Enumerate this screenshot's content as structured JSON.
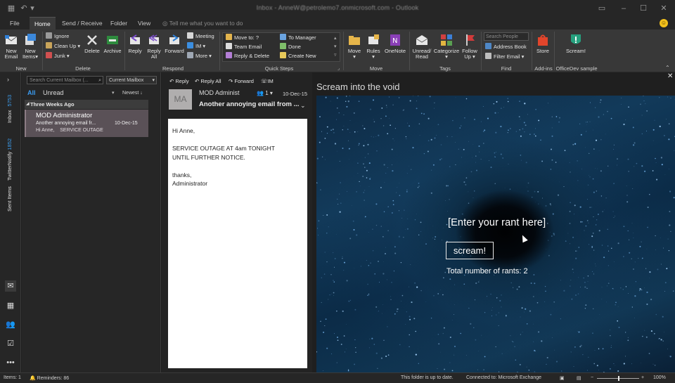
{
  "window": {
    "title": "Inbox - AnneW@petrolemo7.onmicrosoft.com - Outlook",
    "controls": [
      "ribbon-display-icon",
      "minimize-icon",
      "maximize-icon",
      "close-icon"
    ]
  },
  "menu": {
    "tabs": [
      "File",
      "Home",
      "Send / Receive",
      "Folder",
      "View"
    ],
    "active_tab": "Home",
    "tell_me": "Tell me what you want to do"
  },
  "ribbon": {
    "new": {
      "new_email": [
        "New",
        "Email"
      ],
      "new_items": [
        "New",
        "Items"
      ],
      "group": "New"
    },
    "delete": {
      "ignore": "Ignore",
      "cleanup": "Clean Up",
      "junk": "Junk",
      "delete": "Delete",
      "archive": "Archive",
      "group": "Delete"
    },
    "respond": {
      "reply": "Reply",
      "reply_all": [
        "Reply",
        "All"
      ],
      "forward": "Forward",
      "meeting": "Meeting",
      "im": "IM",
      "more": "More",
      "group": "Respond"
    },
    "quick_steps": {
      "items": [
        "Move to: ?",
        "Team Email",
        "Reply & Delete",
        "To Manager",
        "Done",
        "Create New"
      ],
      "group": "Quick Steps"
    },
    "move": {
      "move": "Move",
      "rules": "Rules",
      "onenote": "OneNote",
      "group": "Move"
    },
    "tags": {
      "unread_read": [
        "Unread/",
        "Read"
      ],
      "categorize": "Categorize",
      "follow_up": [
        "Follow",
        "Up"
      ],
      "group": "Tags"
    },
    "find": {
      "search_people": "Search People",
      "address_book": "Address Book",
      "filter_email": "Filter Email",
      "group": "Find"
    },
    "addins": {
      "store": "Store",
      "group": "Add-ins"
    },
    "officedev": {
      "scream": "Scream!",
      "group": "OfficeDev sample"
    }
  },
  "left_nav": {
    "folders": [
      {
        "count": "5753",
        "name": "Inbox"
      },
      {
        "count": "1852",
        "name": "TwitterNotify"
      },
      {
        "count": "",
        "name": "Sent Items"
      }
    ],
    "icons": [
      "mail-icon",
      "calendar-icon",
      "people-icon",
      "tasks-icon",
      "more-icon"
    ]
  },
  "mail_list": {
    "search_placeholder": "Search Current Mailbox (...",
    "scope": "Current Mailbox",
    "filters": {
      "all": "All",
      "unread": "Unread",
      "sort": "Newest"
    },
    "group_header": "Three Weeks Ago",
    "items": [
      {
        "sender": "MOD Administrator",
        "subject": "Another annoying email fr...",
        "date": "10-Dec-15",
        "preview": "Hi Anne,    SERVICE OUTAGE"
      }
    ]
  },
  "reading": {
    "actions": [
      "Reply",
      "Reply All",
      "Forward",
      "IM"
    ],
    "avatar_initials": "MA",
    "sender": "MOD Administ",
    "recipients_count": "1",
    "date": "10-Dec-15",
    "subject": "Another annoying email from ...",
    "body": [
      "Hi Anne,",
      "",
      "SERVICE OUTAGE AT 4am TONIGHT",
      "UNTIL FURTHER NOTICE.",
      "",
      "thanks,",
      "Administrator"
    ]
  },
  "addin": {
    "title": "Scream into the void",
    "rant_placeholder": "[Enter your rant here]",
    "button": "scream!",
    "count_text": "Total number of rants: 2"
  },
  "status": {
    "items": "Items: 1",
    "reminders": "Reminders: 86",
    "folder_status": "This folder is up to date.",
    "connection": "Connected to: Microsoft Exchange",
    "zoom": "100%"
  },
  "colors": {
    "accent": "#3a9bf0",
    "selected_item": "#5a5157",
    "ribbon_bg": "#383838",
    "space_bg": "#0e2a44"
  }
}
